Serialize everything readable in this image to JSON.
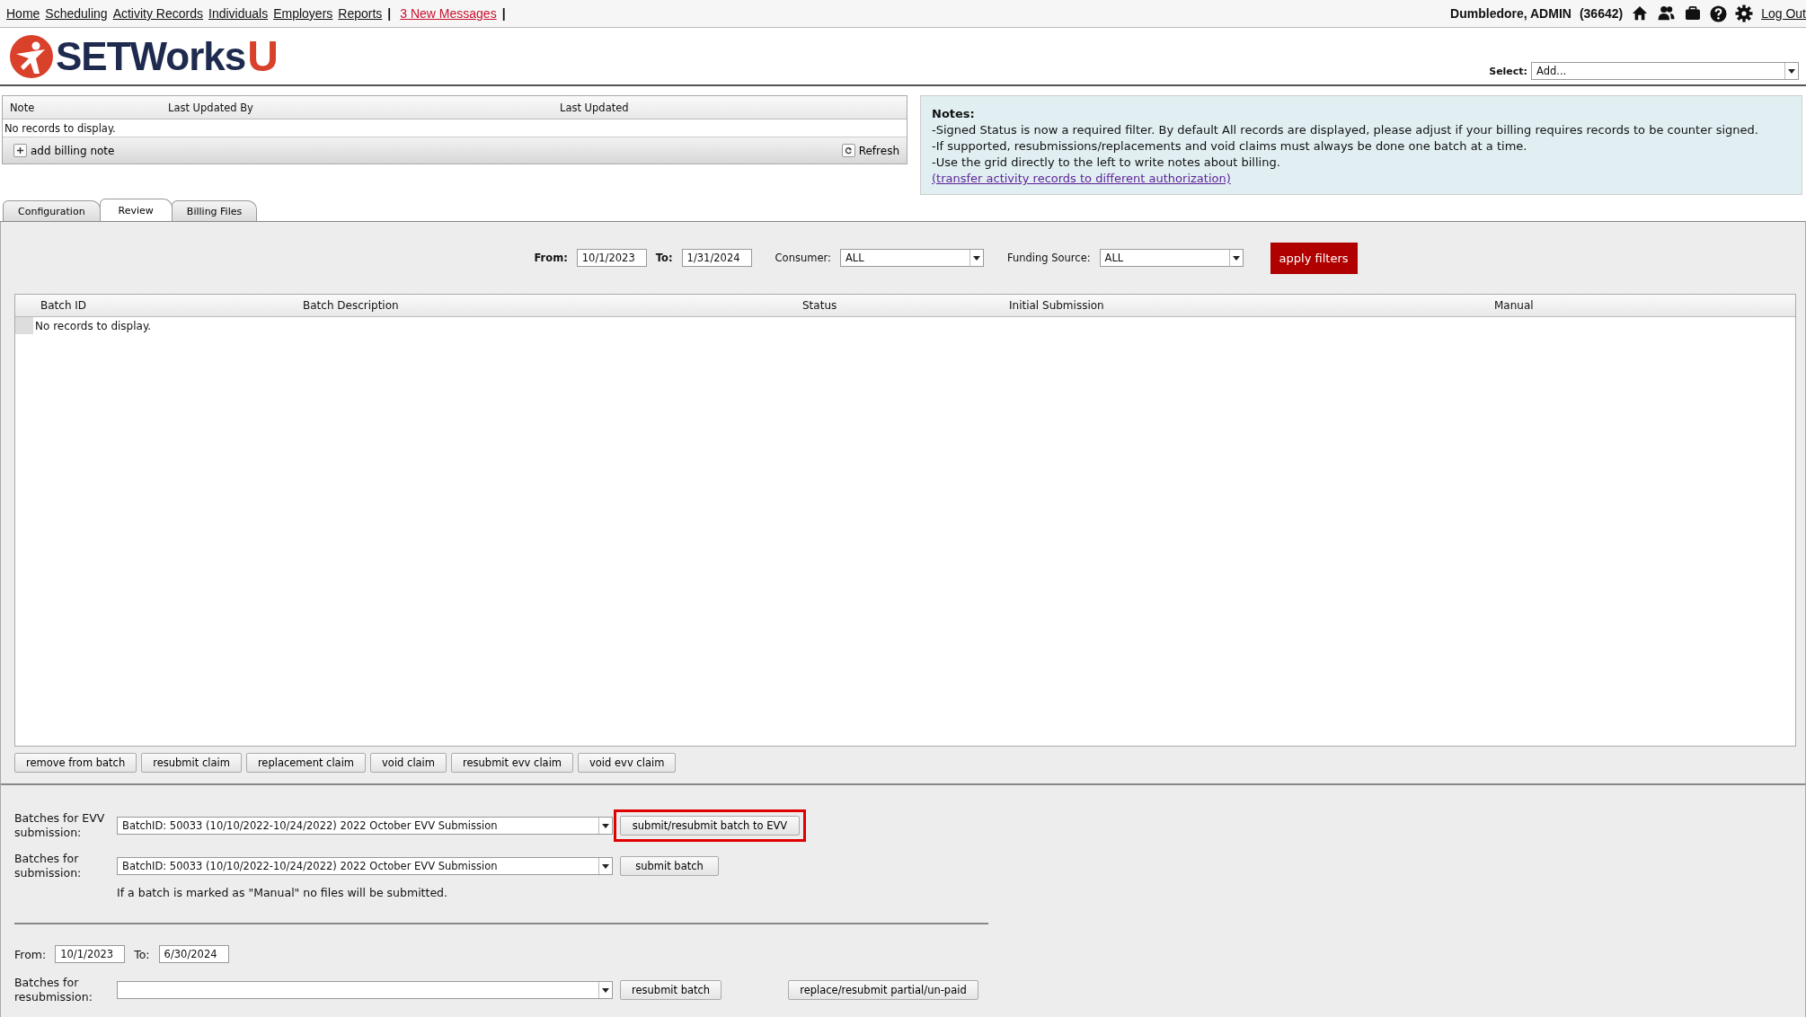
{
  "top_nav": {
    "links": [
      "Home",
      "Scheduling",
      "Activity Records",
      "Individuals",
      "Employers",
      "Reports"
    ],
    "separator_1": "|",
    "messages_link": "3 New Messages",
    "separator_2": "|",
    "user": "Dumbledore, ADMIN",
    "user_id": "(36642)",
    "logout": "Log Out"
  },
  "logo": {
    "text_main": "SETWorks",
    "text_accent": "U"
  },
  "add_select": {
    "label": "Select:",
    "value": "Add..."
  },
  "billing_notes": {
    "columns": [
      "Note",
      "Last Updated By",
      "Last Updated"
    ],
    "empty_message": "No records to display.",
    "add_button": "add billing note",
    "refresh_button": "Refresh"
  },
  "notes": {
    "title": "Notes:",
    "lines": [
      "-Signed Status is now a required filter. By default All records are displayed, please adjust if your billing requires records to be counter signed.",
      "-If supported, resubmissions/replacements and void claims must always be done one batch at a time.",
      "-Use the grid directly to the left to write notes about billing."
    ],
    "link": "(transfer activity records to different authorization)"
  },
  "tabs": [
    {
      "label": "Configuration",
      "selected": false
    },
    {
      "label": "Review",
      "selected": true
    },
    {
      "label": "Billing Files",
      "selected": false
    }
  ],
  "filters": {
    "from_label": "From:",
    "from_value": "10/1/2023",
    "to_label": "To:",
    "to_value": "1/31/2024",
    "consumer_label": "Consumer:",
    "consumer_value": "ALL",
    "funding_label": "Funding Source:",
    "funding_value": "ALL",
    "apply_button": "apply filters"
  },
  "batch_grid": {
    "columns": [
      "Batch ID",
      "Batch Description",
      "Status",
      "Initial Submission",
      "Manual"
    ],
    "empty_message": "No records to display."
  },
  "grid_actions": [
    "remove from batch",
    "resubmit claim",
    "replacement claim",
    "void claim",
    "resubmit evv claim",
    "void evv claim"
  ],
  "evv_submission": {
    "label": "Batches for EVV submission:",
    "value": "BatchID: 50033 (10/10/2022-10/24/2022) 2022 October EVV Submission",
    "button": {
      "label": "submit/resubmit batch to EVV",
      "highlighted": true
    }
  },
  "submission": {
    "label": "Batches for submission:",
    "value": "BatchID: 50033 (10/10/2022-10/24/2022) 2022 October EVV Submission",
    "button": {
      "label": "submit batch"
    },
    "note": "If a batch is marked as \"Manual\" no files will be submitted."
  },
  "resubmission": {
    "from_label": "From:",
    "from_value": "10/1/2023",
    "to_label": "To:",
    "to_value": "6/30/2024",
    "label": "Batches for resubmission:",
    "button": "resubmit batch",
    "partial_button": "replace/resubmit partial/un-paid"
  }
}
